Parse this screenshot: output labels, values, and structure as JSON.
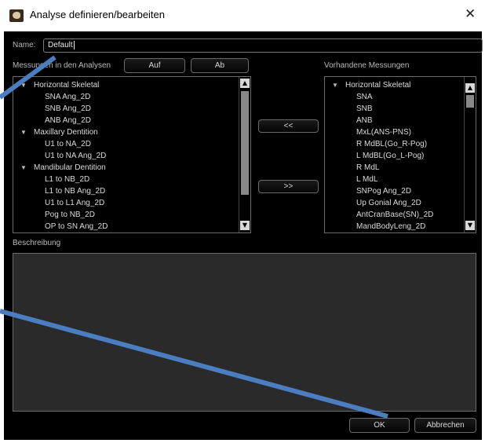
{
  "window": {
    "title": "Analyse definieren/bearbeiten"
  },
  "name_field": {
    "label": "Name:",
    "value": "Default"
  },
  "left_panel": {
    "label": "Messungen in den Analysen",
    "up_button": "Auf",
    "down_button": "Ab",
    "items": [
      {
        "text": "Horizontal Skeletal",
        "group": true
      },
      {
        "text": "SNA Ang_2D",
        "group": false
      },
      {
        "text": "SNB Ang_2D",
        "group": false
      },
      {
        "text": "ANB Ang_2D",
        "group": false
      },
      {
        "text": "Maxillary Dentition",
        "group": true
      },
      {
        "text": "U1 to NA_2D",
        "group": false
      },
      {
        "text": "U1 to NA Ang_2D",
        "group": false
      },
      {
        "text": "Mandibular Dentition",
        "group": true
      },
      {
        "text": "L1 to NB_2D",
        "group": false
      },
      {
        "text": "L1 to NB Ang_2D",
        "group": false
      },
      {
        "text": "U1 to L1 Ang_2D",
        "group": false
      },
      {
        "text": "Pog to NB_2D",
        "group": false
      },
      {
        "text": "OP to SN Ang_2D",
        "group": false
      }
    ]
  },
  "transfer": {
    "left": "<<",
    "right": ">>"
  },
  "right_panel": {
    "label": "Vorhandene Messungen",
    "items": [
      {
        "text": "Horizontal Skeletal",
        "group": true
      },
      {
        "text": "SNA",
        "group": false
      },
      {
        "text": "SNB",
        "group": false
      },
      {
        "text": "ANB",
        "group": false
      },
      {
        "text": "MxL(ANS-PNS)",
        "group": false
      },
      {
        "text": "R MdBL(Go_R-Pog)",
        "group": false
      },
      {
        "text": "L MdBL(Go_L-Pog)",
        "group": false
      },
      {
        "text": "R MdL",
        "group": false
      },
      {
        "text": "L MdL",
        "group": false
      },
      {
        "text": "SNPog Ang_2D",
        "group": false
      },
      {
        "text": "Up Gonial Ang_2D",
        "group": false
      },
      {
        "text": "AntCranBase(SN)_2D",
        "group": false
      },
      {
        "text": "MandBodyLeng_2D",
        "group": false
      }
    ]
  },
  "description": {
    "label": "Beschreibung",
    "value": ""
  },
  "footer": {
    "ok": "OK",
    "cancel": "Abbrechen"
  },
  "colors": {
    "annotation_line": "#4a7ec0",
    "dialog_bg": "#000000"
  },
  "icons": {
    "scroll_up": "▲",
    "scroll_down": "▼",
    "expand": "▼",
    "close": "✕"
  }
}
